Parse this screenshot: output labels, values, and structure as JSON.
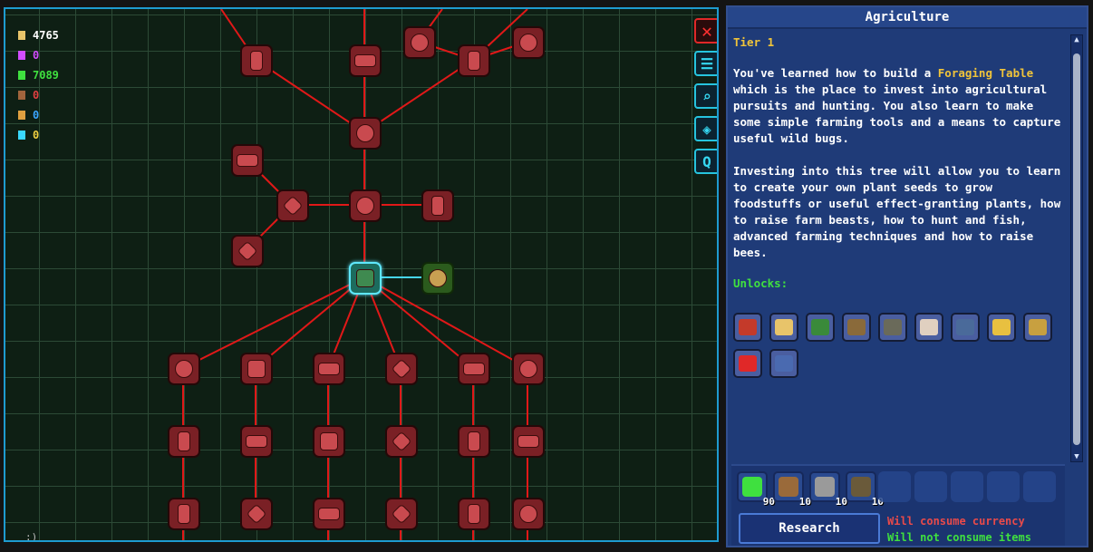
{
  "currencies": [
    {
      "icon": "pixels-icon",
      "value": "4765",
      "color": "#ffffff",
      "icon_color": "#e8c46a"
    },
    {
      "icon": "essence-icon",
      "value": "0",
      "color": "#d24dff",
      "icon_color": "#d24dff"
    },
    {
      "icon": "research-icon",
      "value": "7089",
      "color": "#3fe03f",
      "icon_color": "#3fe03f"
    },
    {
      "icon": "tree-token-icon",
      "value": "0",
      "color": "#e24040",
      "icon_color": "#a0643c"
    },
    {
      "icon": "dna-icon",
      "value": "0",
      "color": "#3aa6ff",
      "icon_color": "#e0a040"
    },
    {
      "icon": "crystal-icon",
      "value": "0",
      "color": "#f0d040",
      "icon_color": "#3ad8ff"
    }
  ],
  "tools": [
    {
      "name": "close-button",
      "icon": "close-icon",
      "glyph": "✕"
    },
    {
      "name": "list-button",
      "icon": "list-icon",
      "glyph": "☰"
    },
    {
      "name": "zoom-button",
      "icon": "magnifier-icon",
      "glyph": "⌕"
    },
    {
      "name": "center-button",
      "icon": "target-icon",
      "glyph": "◈"
    },
    {
      "name": "search-button",
      "icon": "search-icon",
      "glyph": "Q"
    }
  ],
  "corner_glyph": ":)",
  "panel": {
    "title": "Agriculture",
    "tier": "Tier 1",
    "desc1_a": "You've learned how to build a ",
    "desc1_highlight": "Foraging Table",
    "desc1_b": " which is the place to invest into agricultural pursuits and hunting. You also learn to make some simple farming tools and a means to capture useful wild bugs.",
    "desc2": "Investing into this tree will allow you to learn to create your own plant seeds to grow foodstuffs or useful effect-granting plants, how to raise farm beasts, how to hunt and fish, advanced farming techniques and how to raise bees.",
    "unlocks_label": "Unlocks:",
    "unlocks": [
      {
        "icon": "foraging-table-icon",
        "color": "#c43a2a"
      },
      {
        "icon": "flag-icon",
        "color": "#e8c46a"
      },
      {
        "icon": "fishing-rod-icon",
        "color": "#3a8a3a"
      },
      {
        "icon": "bucket-icon",
        "color": "#8a6a3a"
      },
      {
        "icon": "crate-icon",
        "color": "#6a6a5a"
      },
      {
        "icon": "bug-net-icon",
        "color": "#e0d0c0"
      },
      {
        "icon": "terrarium-icon",
        "color": "#4a6a9a"
      },
      {
        "icon": "bee-icon",
        "color": "#e8c040"
      },
      {
        "icon": "spear-icon",
        "color": "#c8a040"
      },
      {
        "icon": "red-tool-icon",
        "color": "#e02828"
      },
      {
        "icon": "staff-icon",
        "color": "#4a6ab0"
      }
    ],
    "costs": [
      {
        "icon": "research-flask-icon",
        "qty": "90",
        "color": "#3fe03f"
      },
      {
        "icon": "wood-icon",
        "qty": "10",
        "color": "#9a6a3a"
      },
      {
        "icon": "stone-icon",
        "qty": "10",
        "color": "#9a9a9a"
      },
      {
        "icon": "fiber-icon",
        "qty": "10",
        "color": "#6a5a3a"
      }
    ],
    "research_label": "Research",
    "warn_currency": "Will consume currency",
    "warn_items": "Will not consume items"
  },
  "tree_nodes": [
    {
      "id": "seed-a",
      "state": "locked"
    },
    {
      "id": "hook",
      "state": "locked"
    },
    {
      "id": "meat",
      "state": "locked"
    },
    {
      "id": "berry-b",
      "state": "locked"
    },
    {
      "id": "coral",
      "state": "locked"
    },
    {
      "id": "rose",
      "state": "locked"
    },
    {
      "id": "sign",
      "state": "locked"
    },
    {
      "id": "hourglass-a",
      "state": "locked"
    },
    {
      "id": "fruit",
      "state": "locked"
    },
    {
      "id": "pineapple",
      "state": "locked"
    },
    {
      "id": "hourglass-b",
      "state": "locked"
    },
    {
      "id": "foraging-table",
      "state": "researched"
    },
    {
      "id": "bug-net",
      "state": "available"
    },
    {
      "id": "r1c1",
      "state": "locked"
    },
    {
      "id": "r1c2",
      "state": "locked"
    },
    {
      "id": "r1c3",
      "state": "locked"
    },
    {
      "id": "r1c4",
      "state": "locked"
    },
    {
      "id": "r1c5",
      "state": "locked"
    },
    {
      "id": "r1c6",
      "state": "locked"
    },
    {
      "id": "r2c1",
      "state": "locked"
    },
    {
      "id": "r2c2",
      "state": "locked"
    },
    {
      "id": "r2c3",
      "state": "locked"
    },
    {
      "id": "r2c4",
      "state": "locked"
    },
    {
      "id": "r2c5",
      "state": "locked"
    },
    {
      "id": "r2c6",
      "state": "locked"
    },
    {
      "id": "r3c1",
      "state": "locked"
    },
    {
      "id": "r3c2",
      "state": "locked"
    },
    {
      "id": "r3c3",
      "state": "locked"
    },
    {
      "id": "r3c4",
      "state": "locked"
    },
    {
      "id": "r3c5",
      "state": "locked"
    },
    {
      "id": "r3c6",
      "state": "locked"
    }
  ]
}
